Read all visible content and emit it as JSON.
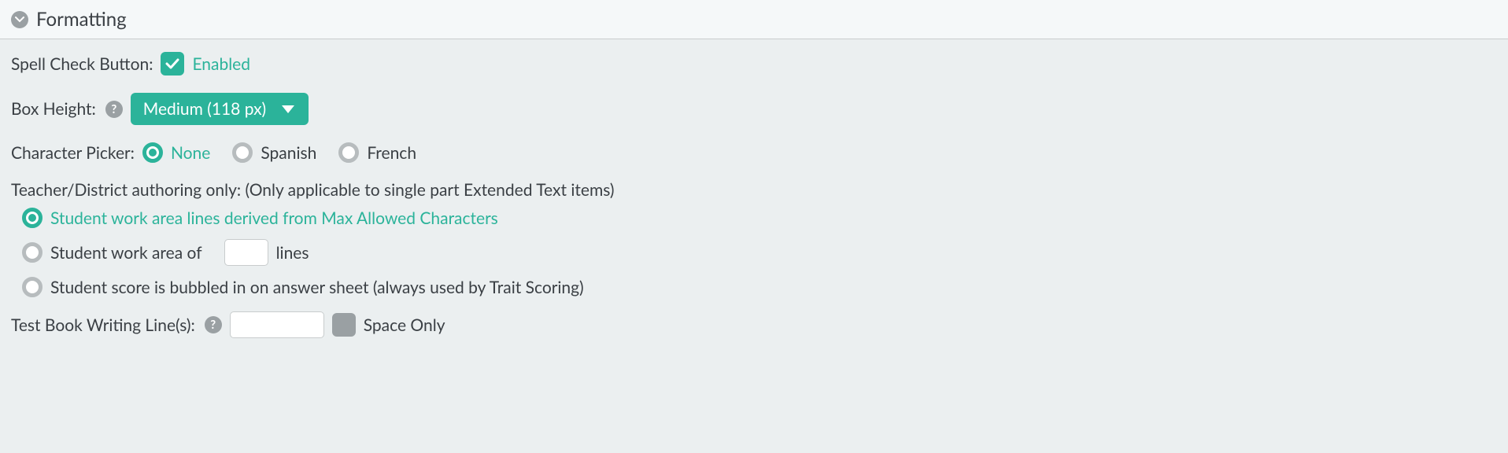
{
  "section": {
    "title": "Formatting"
  },
  "spell_check": {
    "label": "Spell Check Button:",
    "status_label": "Enabled",
    "checked": true
  },
  "box_height": {
    "label": "Box Height:",
    "selected": "Medium (118 px)"
  },
  "character_picker": {
    "label": "Character Picker:",
    "options": [
      {
        "label": "None",
        "selected": true
      },
      {
        "label": "Spanish",
        "selected": false
      },
      {
        "label": "French",
        "selected": false
      }
    ]
  },
  "authoring": {
    "note": "Teacher/District authoring only: (Only applicable to single part Extended Text items)",
    "options": {
      "derived": {
        "label": "Student work area lines derived from Max Allowed Characters",
        "selected": true
      },
      "fixed_lines": {
        "prefix": "Student work area of",
        "suffix": "lines",
        "value": "",
        "selected": false
      },
      "bubbled": {
        "label": "Student score is bubbled in on answer sheet (always used by Trait Scoring)",
        "selected": false
      }
    }
  },
  "test_book": {
    "label": "Test Book Writing Line(s):",
    "value": "",
    "space_only_label": "Space Only",
    "space_only_checked": false
  }
}
